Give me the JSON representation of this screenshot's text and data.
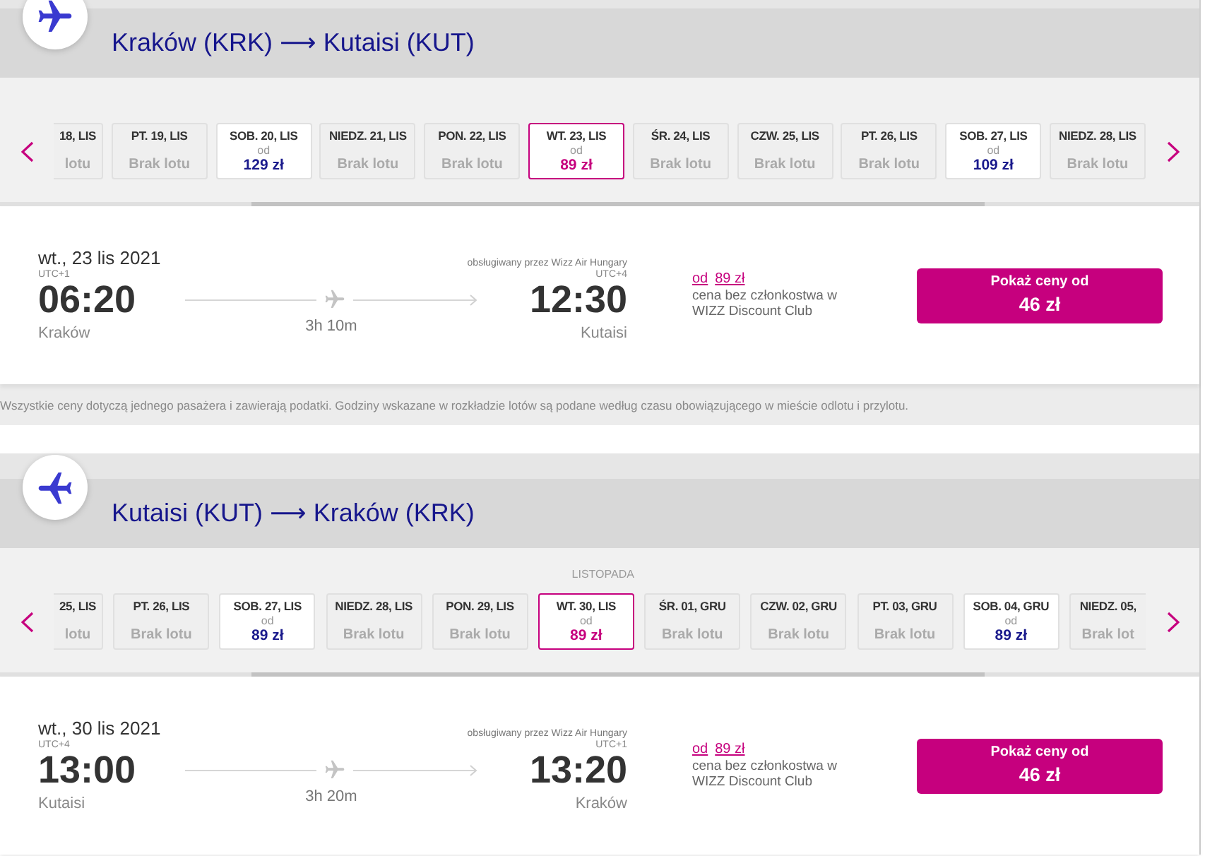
{
  "outbound": {
    "reversed": false,
    "title": "Kraków (KRK) ⟶ Kutaisi (KUT)",
    "dates": [
      {
        "kind": "none",
        "clipped_left": true,
        "clipped_right": false,
        "date": "18, LIS",
        "status": "lotu",
        "selected": false
      },
      {
        "kind": "none",
        "clipped_left": false,
        "clipped_right": false,
        "date": "PT. 19, LIS",
        "status": "Brak lotu",
        "selected": false
      },
      {
        "kind": "available",
        "clipped_left": false,
        "clipped_right": false,
        "date": "SOB. 20, LIS",
        "from": "od",
        "price": "129 zł",
        "selected": false
      },
      {
        "kind": "none",
        "clipped_left": false,
        "clipped_right": false,
        "date": "NIEDZ. 21, LIS",
        "status": "Brak lotu",
        "selected": false
      },
      {
        "kind": "none",
        "clipped_left": false,
        "clipped_right": false,
        "date": "PON. 22, LIS",
        "status": "Brak lotu",
        "selected": false
      },
      {
        "kind": "available",
        "clipped_left": false,
        "clipped_right": false,
        "date": "WT. 23, LIS",
        "from": "od",
        "price": "89 zł",
        "selected": true
      },
      {
        "kind": "none",
        "clipped_left": false,
        "clipped_right": false,
        "date": "ŚR. 24, LIS",
        "status": "Brak lotu",
        "selected": false
      },
      {
        "kind": "none",
        "clipped_left": false,
        "clipped_right": false,
        "date": "CZW. 25, LIS",
        "status": "Brak lotu",
        "selected": false
      },
      {
        "kind": "none",
        "clipped_left": false,
        "clipped_right": false,
        "date": "PT. 26, LIS",
        "status": "Brak lotu",
        "selected": false
      },
      {
        "kind": "available",
        "clipped_left": false,
        "clipped_right": false,
        "date": "SOB. 27, LIS",
        "from": "od",
        "price": "109 zł",
        "selected": false
      },
      {
        "kind": "none",
        "clipped_left": false,
        "clipped_right": false,
        "date": "NIEDZ. 28, LIS",
        "status": "Brak lotu",
        "selected": false
      }
    ],
    "flight": {
      "date": "wt., 23 lis 2021",
      "operator": "obsługiwany przez Wizz Air Hungary",
      "departure": {
        "utc": "UTC+1",
        "time": "06:20",
        "city": "Kraków"
      },
      "duration": "3h 10m",
      "arrival": {
        "utc": "UTC+4",
        "time": "12:30",
        "city": "Kutaisi"
      }
    },
    "member_price": {
      "from": "od",
      "price": "89 zł",
      "note": "cena bez członkostwa w WIZZ Discount Club"
    },
    "price_button": {
      "label": "Pokaż ceny od",
      "price": "46 zł"
    }
  },
  "footnote": "Wszystkie ceny dotyczą jednego pasażera i zawierają podatki. Godziny wskazane w rozkładzie lotów są podane według czasu obowiązującego w mieście odlotu i przylotu.",
  "return": {
    "reversed": true,
    "title": "Kutaisi (KUT) ⟶ Kraków (KRK)",
    "dates": [
      {
        "kind": "none",
        "clipped_left": true,
        "clipped_right": false,
        "date": "25, LIS",
        "status": "lotu",
        "selected": false
      },
      {
        "kind": "none",
        "clipped_left": false,
        "clipped_right": false,
        "date": "PT. 26, LIS",
        "status": "Brak lotu",
        "selected": false
      },
      {
        "kind": "available",
        "clipped_left": false,
        "clipped_right": false,
        "date": "SOB. 27, LIS",
        "from": "od",
        "price": "89 zł",
        "selected": false
      },
      {
        "kind": "none",
        "clipped_left": false,
        "clipped_right": false,
        "date": "NIEDZ. 28, LIS",
        "status": "Brak lotu",
        "selected": false
      },
      {
        "kind": "none",
        "clipped_left": false,
        "clipped_right": false,
        "date": "PON. 29, LIS",
        "status": "Brak lotu",
        "selected": false
      },
      {
        "kind": "available",
        "clipped_left": false,
        "clipped_right": false,
        "date": "WT. 30, LIS",
        "from": "od",
        "price": "89 zł",
        "selected": true,
        "month": "LISTOPADA"
      },
      {
        "kind": "none",
        "clipped_left": false,
        "clipped_right": false,
        "date": "ŚR. 01, GRU",
        "status": "Brak lotu",
        "selected": false
      },
      {
        "kind": "none",
        "clipped_left": false,
        "clipped_right": false,
        "date": "CZW. 02, GRU",
        "status": "Brak lotu",
        "selected": false
      },
      {
        "kind": "none",
        "clipped_left": false,
        "clipped_right": false,
        "date": "PT. 03, GRU",
        "status": "Brak lotu",
        "selected": false
      },
      {
        "kind": "available",
        "clipped_left": false,
        "clipped_right": false,
        "date": "SOB. 04, GRU",
        "from": "od",
        "price": "89 zł",
        "selected": false
      },
      {
        "kind": "none",
        "clipped_left": false,
        "clipped_right": true,
        "date": "NIEDZ. 05,",
        "status": "Brak lot",
        "selected": false
      }
    ],
    "flight": {
      "date": "wt., 30 lis 2021",
      "operator": "obsługiwany przez Wizz Air Hungary",
      "departure": {
        "utc": "UTC+4",
        "time": "13:00",
        "city": "Kutaisi"
      },
      "duration": "3h 20m",
      "arrival": {
        "utc": "UTC+1",
        "time": "13:20",
        "city": "Kraków"
      }
    },
    "member_price": {
      "from": "od",
      "price": "89 zł",
      "note": "cena bez członkostwa w WIZZ Discount Club"
    },
    "price_button": {
      "label": "Pokaż ceny od",
      "price": "46 zł"
    }
  }
}
